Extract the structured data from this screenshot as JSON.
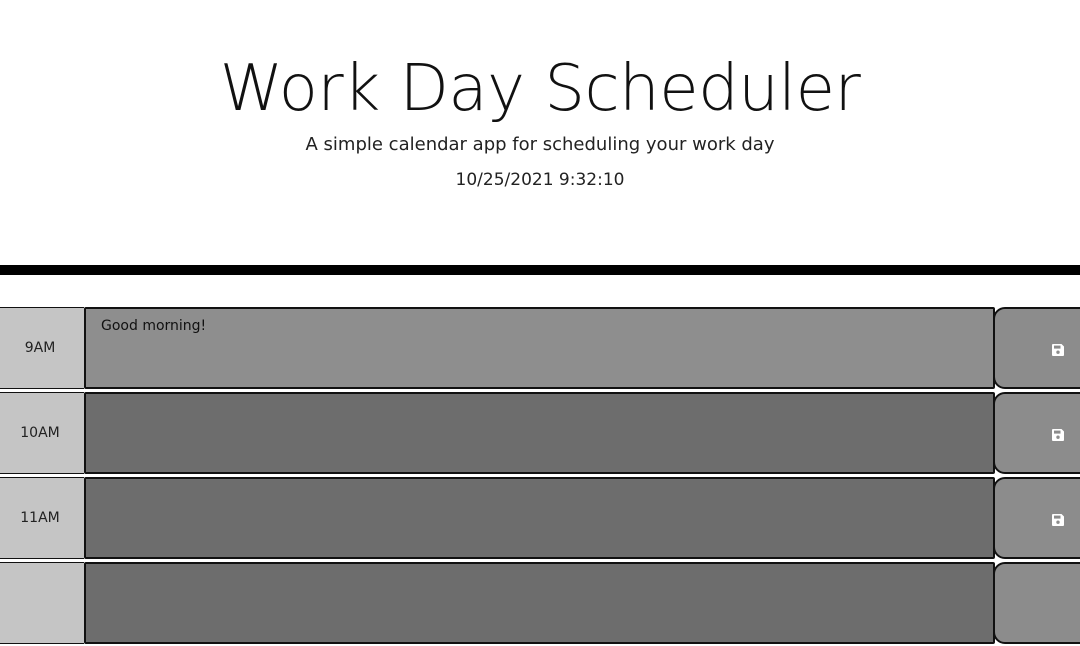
{
  "header": {
    "title": "Work Day Scheduler",
    "subtitle": "A simple calendar app for scheduling your work day",
    "datetime": "10/25/2021 9:32:10"
  },
  "rows": [
    {
      "hour": "9AM",
      "text": "Good morning!",
      "status": "present"
    },
    {
      "hour": "10AM",
      "text": "",
      "status": "future"
    },
    {
      "hour": "11AM",
      "text": "",
      "status": "future"
    }
  ],
  "icons": {
    "save": "save-icon"
  },
  "colors": {
    "present": "#8e8e8e",
    "future": "#6d6d6d",
    "hour_block": "#c5c5c5",
    "save_button": "#8c8c8c",
    "divider": "#000000"
  }
}
